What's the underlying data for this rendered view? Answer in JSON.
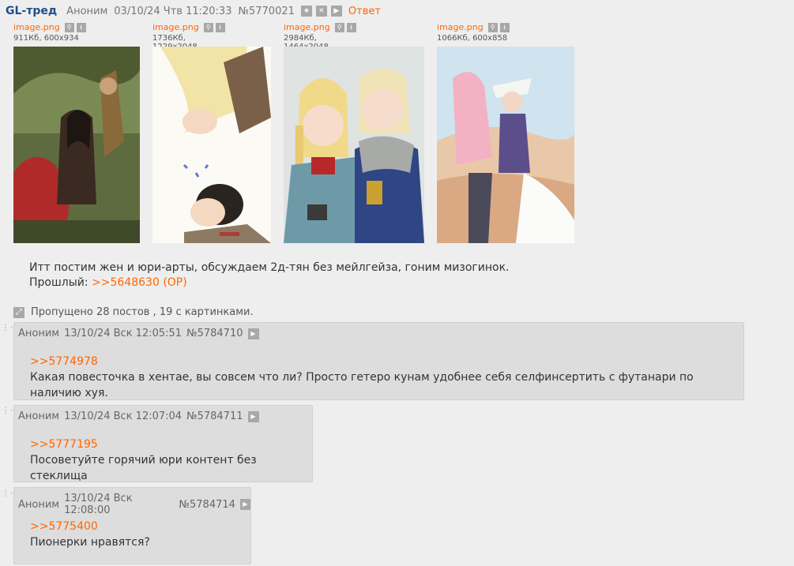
{
  "op": {
    "title": "GL-тред",
    "author": "Аноним",
    "date": "03/10/24 Чтв 11:20:33",
    "number": "№5770021",
    "reply_label": "Ответ",
    "icons": [
      "star-icon",
      "hide-icon",
      "play-icon"
    ],
    "files": [
      {
        "name": "image.png",
        "meta": "911Кб, 600x934"
      },
      {
        "name": "image.png",
        "meta": "1736Кб, 1229x2048"
      },
      {
        "name": "image.png",
        "meta": "2984Кб, 1464x2048"
      },
      {
        "name": "image.png",
        "meta": "1066Кб, 600x858"
      }
    ],
    "text": "Итт постим жен и юри-арты, обсуждаем 2д-тян без мейлгейза, гоним мизогинок.",
    "prev_label": "Прошлый:",
    "prev_link": ">>5648630 (OP)"
  },
  "skipped": "Пропущено 28 постов , 19 с картинками.",
  "posts": [
    {
      "author": "Аноним",
      "date": "13/10/24 Вск 12:05:51",
      "number": "№5784710",
      "link": ">>5774978",
      "text": "Какая повесточка в хентае, вы совсем что ли? Просто гетеро кунам удобнее себя селфинсертить с футанари по наличию хуя."
    },
    {
      "author": "Аноним",
      "date": "13/10/24 Вск 12:07:04",
      "number": "№5784711",
      "link": ">>5777195",
      "text": "Посоветуйте горячий юри контент без стеклища"
    },
    {
      "author": "Аноним",
      "date": "13/10/24 Вск 12:08:00",
      "number": "№5784714",
      "link": ">>5775400",
      "text": "Пионерки нравятся?"
    }
  ]
}
